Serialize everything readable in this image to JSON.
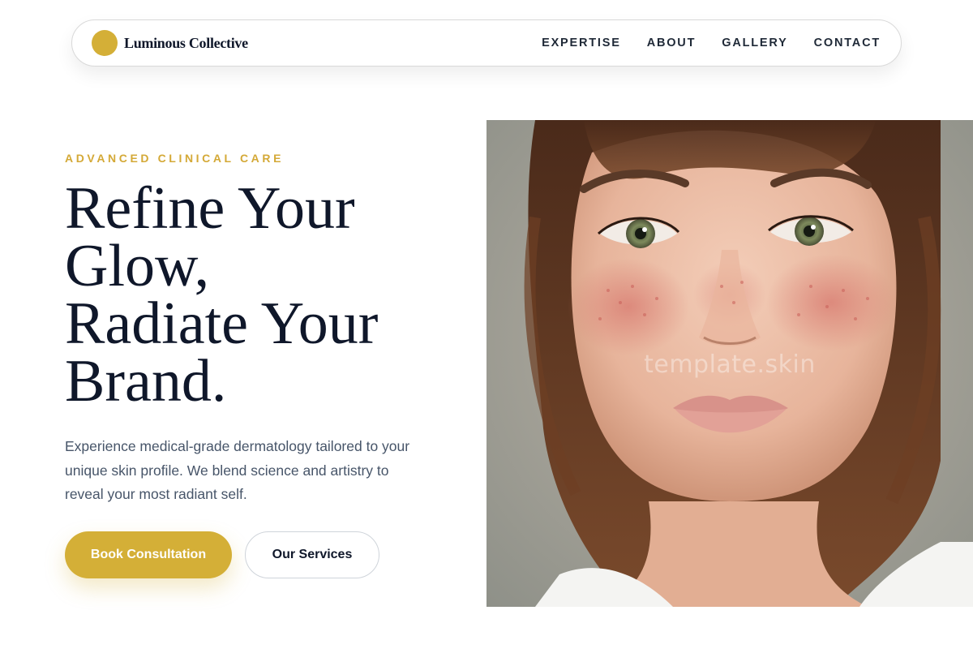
{
  "nav": {
    "brand": "Luminous Collective",
    "links": [
      "EXPERTISE",
      "ABOUT",
      "GALLERY",
      "CONTACT"
    ]
  },
  "hero": {
    "eyebrow": "ADVANCED CLINICAL CARE",
    "headline_lines": [
      "Refine Your",
      "Glow,",
      "Radiate Your",
      "Brand."
    ],
    "description": "Experience medical-grade dermatology tailored to your unique skin profile. We blend science and artistry to reveal your most radiant self.",
    "primary_button": "Book Consultation",
    "secondary_button": "Our Services",
    "image_watermark": "template.skin"
  },
  "colors": {
    "accent": "#d4af37",
    "heading": "#0f172a",
    "body_text": "#475569"
  }
}
